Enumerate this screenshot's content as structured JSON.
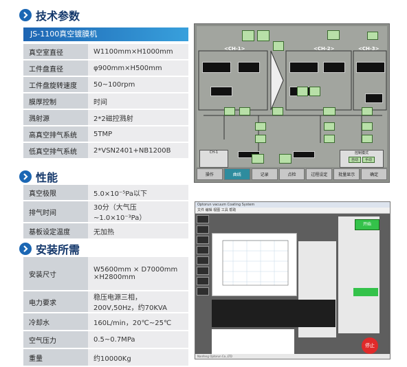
{
  "sections": {
    "tech": "技术参数",
    "performance": "性能",
    "install": "安装所需"
  },
  "banner": "JS-1100真空镀膜机",
  "tech_rows": [
    {
      "k": "真空室直径",
      "v": "W1100mm×H1000mm"
    },
    {
      "k": "工件盘直径",
      "v": "φ900mm×H500mm"
    },
    {
      "k": "工件盘旋转速度",
      "v": "50~100rpm"
    },
    {
      "k": "膜厚控制",
      "v": "时间"
    },
    {
      "k": "溅射源",
      "v": "2*2磁控溅射"
    },
    {
      "k": "高真空排气系统",
      "v": "5TMP"
    },
    {
      "k": "低真空排气系统",
      "v": "2*VSN2401+NB1200B"
    }
  ],
  "perf_rows": [
    {
      "k": "真空极限",
      "v": "5.0×10⁻⁵Pa以下"
    },
    {
      "k": "排气时间",
      "v": "30分（大气压~1.0×10⁻³Pa）"
    },
    {
      "k": "基板设定温度",
      "v": "无加热"
    }
  ],
  "install_rows": [
    {
      "k": "安装尺寸",
      "v": "W5600mm × D7000mm",
      "v2": "×H2800mm"
    },
    {
      "k": "电力要求",
      "v": "稳压电源三相，200V,50Hz，约70KVA"
    },
    {
      "k": "冷却水",
      "v": "160L/min，20℃~25℃"
    },
    {
      "k": "空气压力",
      "v": "0.5~0.7MPa"
    },
    {
      "k": "重量",
      "v": "约10000Kg"
    }
  ],
  "panel": {
    "ch1": "<CH-1>",
    "ch2": "<CH-2>",
    "ch3": "<CH-3>",
    "ch1_ctrl": "CH-1",
    "mode_label": "控制模式",
    "auto": "自动",
    "manual": "手动",
    "tabs": [
      "操作",
      "曲线",
      "记录",
      "点检",
      "过程设定",
      "批量显示",
      "确定"
    ]
  },
  "win": {
    "title": "Optorun vacuum Coating System",
    "menu": "文件  编辑  视图  工具  帮助",
    "status": "Nanfeng Optorun Co.,LTD",
    "stop": "停止",
    "start": "开始"
  },
  "colors": {
    "accent": "#1b67b4",
    "title": "#14386b"
  }
}
